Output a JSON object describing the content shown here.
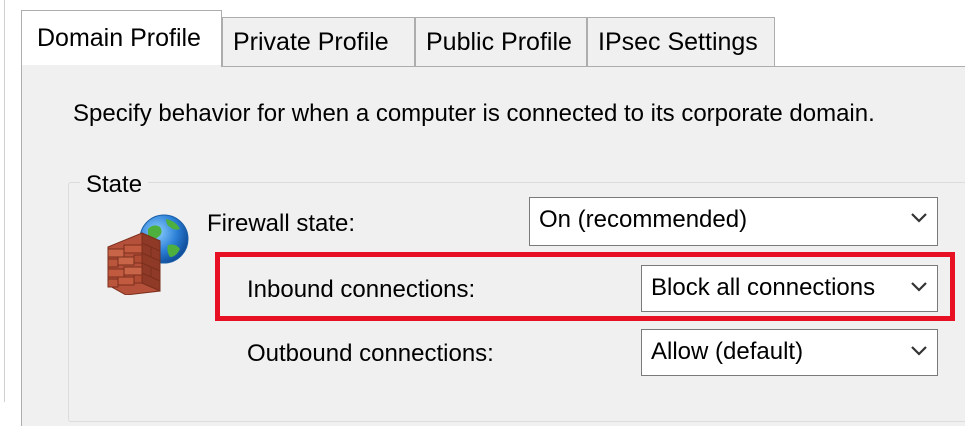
{
  "tabs": [
    {
      "label": "Domain Profile",
      "active": true
    },
    {
      "label": "Private Profile",
      "active": false
    },
    {
      "label": "Public Profile",
      "active": false
    },
    {
      "label": "IPsec Settings",
      "active": false
    }
  ],
  "description": "Specify behavior for when a computer is connected to its corporate domain.",
  "state_group": {
    "title": "State",
    "icon": "firewall-icon",
    "firewall_state": {
      "label": "Firewall state:",
      "value": "On (recommended)"
    },
    "inbound": {
      "label": "Inbound connections:",
      "value": "Block all connections"
    },
    "outbound": {
      "label": "Outbound connections:",
      "value": "Allow (default)"
    }
  },
  "colors": {
    "highlight": "#e81123",
    "panel_background": "#f0f0f0",
    "border": "#adadad"
  }
}
